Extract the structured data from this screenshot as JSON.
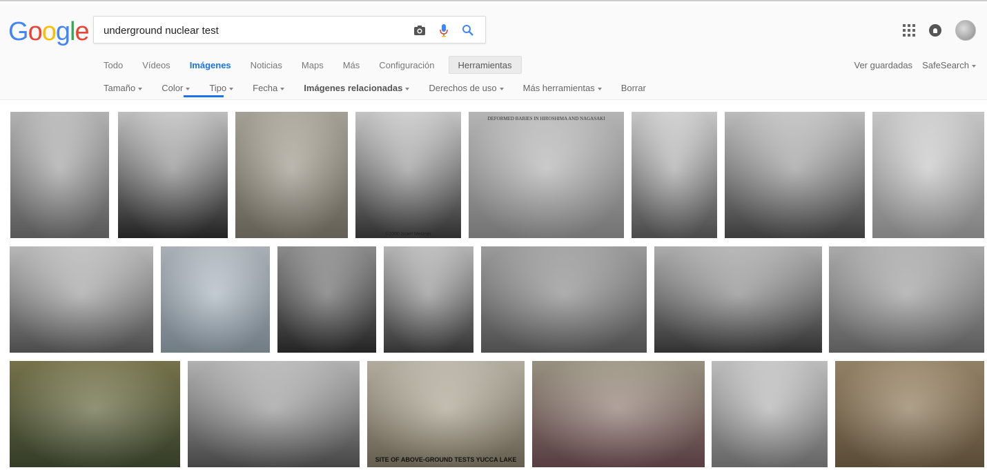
{
  "logo": {
    "letters": [
      "G",
      "o",
      "o",
      "g",
      "l",
      "e"
    ],
    "colors": [
      "#4285f4",
      "#ea4335",
      "#fbbc05",
      "#4285f4",
      "#34a853",
      "#ea4335"
    ]
  },
  "search": {
    "query": "underground nuclear test",
    "icons": [
      "camera-icon",
      "microphone-icon",
      "search-icon"
    ]
  },
  "header_right": {
    "icons": [
      "apps-icon",
      "notifications-icon",
      "account-avatar"
    ]
  },
  "tabs": [
    {
      "label": "Todo"
    },
    {
      "label": "Vídeos"
    },
    {
      "label": "Imágenes",
      "active": true
    },
    {
      "label": "Noticias"
    },
    {
      "label": "Maps"
    },
    {
      "label": "Más"
    },
    {
      "label": "Configuración"
    },
    {
      "label": "Herramientas",
      "tools": true
    }
  ],
  "right_links": {
    "saved": "Ver guardadas",
    "safesearch": "SafeSearch"
  },
  "tools": [
    {
      "label": "Tamaño",
      "caret": true
    },
    {
      "label": "Color",
      "caret": true
    },
    {
      "label": "Tipo",
      "caret": true
    },
    {
      "label": "Fecha",
      "caret": true
    },
    {
      "label": "Imágenes relacionadas",
      "caret": true,
      "bold": true
    },
    {
      "label": "Derechos de uso",
      "caret": true
    },
    {
      "label": "Más herramientas",
      "caret": true
    },
    {
      "label": "Borrar",
      "caret": false
    }
  ],
  "images": [
    {
      "name": "image-result",
      "tone": [
        "#d9d9d9",
        "#6b6b6b"
      ],
      "text": ""
    },
    {
      "name": "image-result",
      "tone": [
        "#e8e8e8",
        "#2a2a2a"
      ],
      "text": ""
    },
    {
      "name": "image-result",
      "tone": [
        "#c9c3b6",
        "#7a7468"
      ],
      "text": ""
    },
    {
      "name": "image-result",
      "tone": [
        "#efefef",
        "#3a3a3a"
      ],
      "text": "©2000 Israel Meizner"
    },
    {
      "name": "image-result",
      "tone": [
        "#dcdcdc",
        "#8c8c8c"
      ],
      "text": "DEFORMED BABIES IN HIROSHIMA AND NAGASAKI"
    },
    {
      "name": "image-result",
      "tone": [
        "#f2f2f2",
        "#5a5a5a"
      ],
      "text": ""
    },
    {
      "name": "image-result",
      "tone": [
        "#e5e5e5",
        "#4a4a4a"
      ],
      "text": ""
    },
    {
      "name": "image-result",
      "tone": [
        "#f0f0f0",
        "#9a9a9a"
      ],
      "text": ""
    },
    {
      "name": "image-result",
      "tone": [
        "#e0e0e0",
        "#5c5c5c"
      ],
      "text": ""
    },
    {
      "name": "image-result",
      "tone": [
        "#cdd6dd",
        "#8a98a3"
      ],
      "text": ""
    },
    {
      "name": "image-result",
      "tone": [
        "#aaaaaa",
        "#2c2c2c"
      ],
      "text": ""
    },
    {
      "name": "image-result",
      "tone": [
        "#dcdcdc",
        "#3f3f3f"
      ],
      "text": ""
    },
    {
      "name": "image-result",
      "tone": [
        "#bdbdbd",
        "#5f5f5f"
      ],
      "text": ""
    },
    {
      "name": "image-result",
      "tone": [
        "#d2d2d2",
        "#3d3d3d"
      ],
      "text": ""
    },
    {
      "name": "image-result",
      "tone": [
        "#cfcfcf",
        "#6e6e6e"
      ],
      "text": ""
    },
    {
      "name": "image-result",
      "tone": [
        "#8f8b5c",
        "#3f4a30"
      ],
      "text": ""
    },
    {
      "name": "image-result",
      "tone": [
        "#d8d8d8",
        "#555555"
      ],
      "text": ""
    },
    {
      "name": "image-result",
      "tone": [
        "#d9d2c2",
        "#7b735f"
      ],
      "text": "SITE OF ABOVE-GROUND TESTS YUCCA LAKE"
    },
    {
      "name": "image-result",
      "tone": [
        "#b8b09b",
        "#6b4a50"
      ],
      "text": ""
    },
    {
      "name": "image-result",
      "tone": [
        "#e6e6e6",
        "#7a7a7a"
      ],
      "text": ""
    },
    {
      "name": "image-result",
      "tone": [
        "#b39d7c",
        "#6e5c43"
      ],
      "text": ""
    }
  ]
}
